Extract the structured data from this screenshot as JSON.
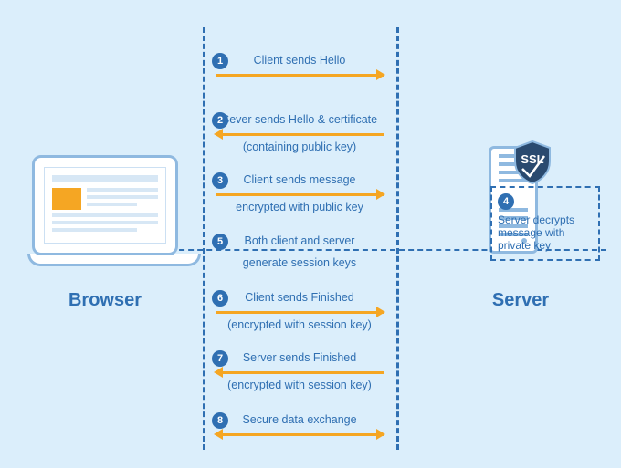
{
  "labels": {
    "browser": "Browser",
    "server": "Server",
    "ssl": "SSL"
  },
  "steps": {
    "s1": {
      "n": "1",
      "text": "Client sends Hello"
    },
    "s2": {
      "n": "2",
      "text": "Sever sends Hello & certificate",
      "sub": "(containing public key)"
    },
    "s3": {
      "n": "3",
      "text": "Client sends message",
      "sub": "encrypted with public key"
    },
    "s4": {
      "n": "4",
      "text": "Server decrypts message with private key"
    },
    "s5": {
      "n": "5",
      "text": "Both client and server",
      "sub": "generate session keys"
    },
    "s6": {
      "n": "6",
      "text": "Client sends Finished",
      "sub": "(encrypted with session key)"
    },
    "s7": {
      "n": "7",
      "text": "Server sends Finished",
      "sub": "(encrypted with session key)"
    },
    "s8": {
      "n": "8",
      "text": "Secure data exchange"
    }
  }
}
